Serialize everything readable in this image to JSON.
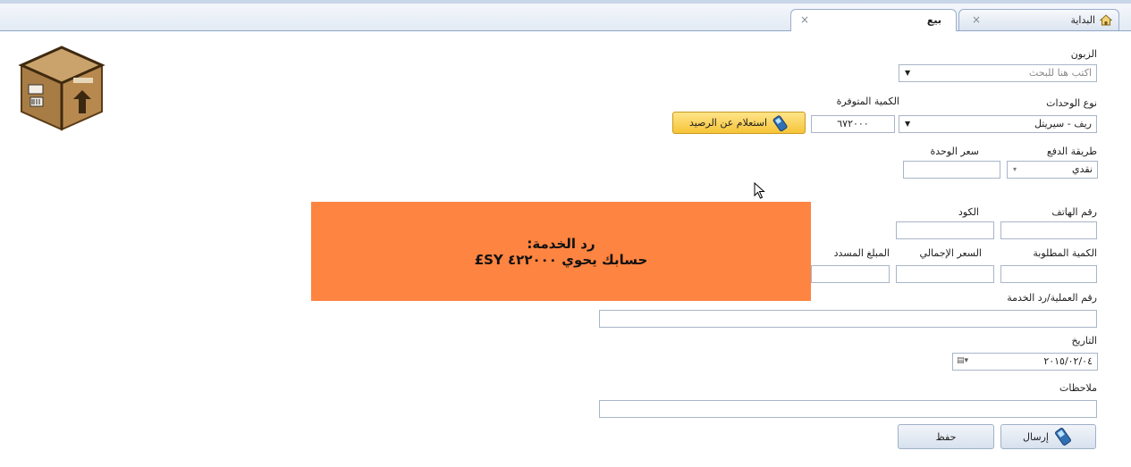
{
  "tabs": {
    "home_label": "البداية",
    "sell_label": "بيع",
    "close_symbol": "×"
  },
  "form": {
    "customer": {
      "label": "الزبون",
      "placeholder": "اكتب هنا للبحث"
    },
    "unit_type": {
      "label": "نوع الوحدات",
      "value": "ريف - سيريتل"
    },
    "available_qty": {
      "label": "الكمية المتوفرة",
      "value": "٦٧٢٠٠٠"
    },
    "balance_inquiry_button": "استعلام عن الرصيد",
    "payment_method": {
      "label": "طريقة الدفع",
      "value": "نقدي"
    },
    "unit_price": {
      "label": "سعر الوحدة",
      "value": ""
    },
    "phone": {
      "label": "رقم الهاتف",
      "value": ""
    },
    "code": {
      "label": "الكود",
      "value": ""
    },
    "requested_qty": {
      "label": "الكمية المطلوبة",
      "value": ""
    },
    "total_price": {
      "label": "السعر الإجمالي",
      "value": ""
    },
    "paid_amount": {
      "label": "المبلغ المسدد",
      "value": ""
    },
    "operation_number": {
      "label": "رقم العملية/رد الخدمة",
      "value": ""
    },
    "date": {
      "label": "التاريخ",
      "value": "٢٠١٥/٠٢/٠٤"
    },
    "notes": {
      "label": "ملاحظات",
      "value": ""
    },
    "send_button": "إرسال",
    "save_button": "حفظ"
  },
  "service_response": {
    "line1": "رد الخدمة:",
    "line2": "حسابك يحوي ٤٢٢٠٠٠ SY£"
  },
  "colors": {
    "banner": "#fe8441",
    "tabbar": "#e3eaf4",
    "yellow_button": "#f6c437"
  }
}
